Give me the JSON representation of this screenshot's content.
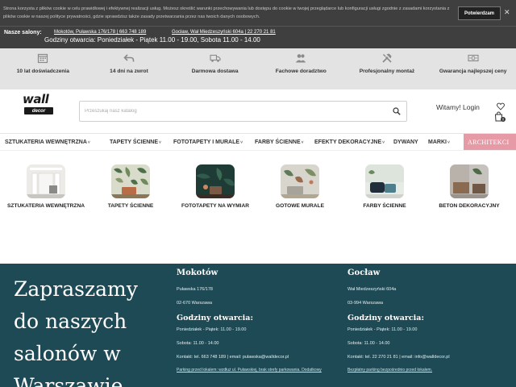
{
  "cookie": {
    "text": "Strona korzysta z plików cookie w celu prawidłowej i efektywnej realizacji usług. Możesz określić warunki przechowywania lub dostępu do cookie w twojej przeglądarce lub konfiguracji usługi zgodnie z zasadami korzystania z plików cookie w naszej polityce prywatności, gdzie sprawdzisz także zasady przetwarzania przez nas twoich danych osobowych.",
    "accept_label": "Potwierdzam",
    "close_label": "✕"
  },
  "salons": {
    "title": "Nasze salony:",
    "mokotow": "Mokotów, Puławska 176/178 | 663 748 189",
    "goclaw": "Gocław, Wał Miedzeszyński 604a | 22 270 21 81",
    "hours": "Godziny otwarcia: Poniedziałek - Piątek 11.00 - 19.00, Sobota 11.00 - 14.00"
  },
  "benefits": [
    {
      "label": "10 lat doświadczenia",
      "icon": "calendar-icon"
    },
    {
      "label": "14 dni na zwrot",
      "icon": "return-arrow-icon"
    },
    {
      "label": "Darmowa dostawa",
      "icon": "truck-icon"
    },
    {
      "label": "Fachowe doradztwo",
      "icon": "people-icon"
    },
    {
      "label": "Profesjonalny montaż",
      "icon": "tools-icon"
    },
    {
      "label": "Gwarancja najlepszej ceny",
      "icon": "money-icon"
    }
  ],
  "header": {
    "logo_top": "wall",
    "logo_bottom": "decor",
    "search_placeholder": "Przeszukaj nasz katalog",
    "login": "Witamy! Login"
  },
  "nav": {
    "items": [
      {
        "label": "SZTUKATERIA WEWNĘTRZNA",
        "caret": "˅"
      },
      {
        "label": "TAPETY ŚCIENNE",
        "caret": "˅"
      },
      {
        "label": "FOTOTAPETY I MURALE",
        "caret": "˅"
      },
      {
        "label": "FARBY ŚCIENNE",
        "caret": "˅"
      },
      {
        "label": "EFEKTY DEKORACYJNE",
        "caret": "˅"
      },
      {
        "label": "DYWANY",
        "caret": ""
      },
      {
        "label": "MARKI",
        "caret": "˅"
      }
    ],
    "architects": "ARCHITEKCI"
  },
  "categories": [
    {
      "label": "SZTUKATERIA WEWNĘTRZNA"
    },
    {
      "label": "TAPETY ŚCIENNE"
    },
    {
      "label": "FOTOTAPETY NA WYMIAR"
    },
    {
      "label": "GOTOWE MURALE"
    },
    {
      "label": "FARBY ŚCIENNE"
    },
    {
      "label": "BETON DEKORACYJNY"
    }
  ],
  "footer": {
    "headline": "Zapraszamy do naszych salonów w Warszawie",
    "mokotow": {
      "title": "Mokotów",
      "street": "Puławska 176/178",
      "city": "02-670 Warszawa",
      "hours_title": "Godziny otwarcia:",
      "weekdays": "Poniedziałek - Piątek: 11.00 - 19.00",
      "saturday": "Sobota: 11.00 - 14.00",
      "contact": "Kontakt: tel. 663 748 189 | email: pulawska@walldecor.pl",
      "note": "Parking przed lokalem: wzdłuż ul. Puławskiej, brak strefy parkowania. Dodatkowy"
    },
    "goclaw": {
      "title": "Gocław",
      "street": "Wał Miedzeszyński 604a",
      "city": "03-994 Warszawa",
      "hours_title": "Godziny otwarcia:",
      "weekdays": "Poniedziałek - Piątek: 11.00 - 19.00",
      "saturday": "Sobota: 11.00 - 14.00",
      "contact": "Kontakt: tel. 22 270 21 81 | email: info@walldecor.pl",
      "note": "Bezpłatny parking bezpośrednio przed lokalem."
    }
  },
  "colors": {
    "top_bar": "#3f3f3f",
    "benefits_bg": "#e3e3e3",
    "architects": "#e59aa6",
    "footer_bg": "#1d4a55"
  }
}
